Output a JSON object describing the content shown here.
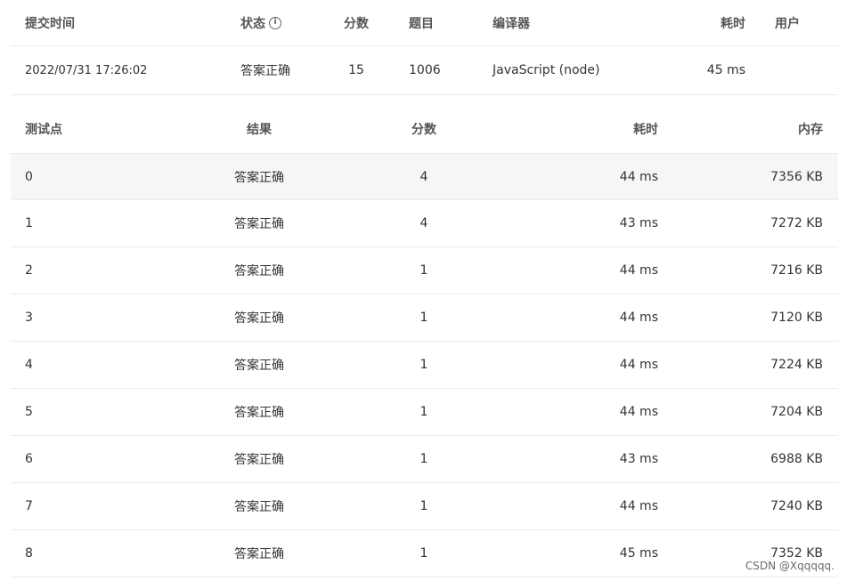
{
  "submission": {
    "headers": {
      "time": "提交时间",
      "status": "状态",
      "score": "分数",
      "problem": "题目",
      "compiler": "编译器",
      "cost": "耗时",
      "user": "用户"
    },
    "status_info_icon": "info-circle-icon",
    "row": {
      "time": "2022/07/31 17:26:02",
      "status": "答案正确",
      "score": "15",
      "problem": "1006",
      "compiler": "JavaScript (node)",
      "cost": "45 ms",
      "user": ""
    }
  },
  "cases": {
    "headers": {
      "id": "测试点",
      "result": "结果",
      "score": "分数",
      "cost": "耗时",
      "memory": "内存"
    },
    "rows": [
      {
        "id": "0",
        "result": "答案正确",
        "score": "4",
        "cost": "44 ms",
        "memory": "7356 KB"
      },
      {
        "id": "1",
        "result": "答案正确",
        "score": "4",
        "cost": "43 ms",
        "memory": "7272 KB"
      },
      {
        "id": "2",
        "result": "答案正确",
        "score": "1",
        "cost": "44 ms",
        "memory": "7216 KB"
      },
      {
        "id": "3",
        "result": "答案正确",
        "score": "1",
        "cost": "44 ms",
        "memory": "7120 KB"
      },
      {
        "id": "4",
        "result": "答案正确",
        "score": "1",
        "cost": "44 ms",
        "memory": "7224 KB"
      },
      {
        "id": "5",
        "result": "答案正确",
        "score": "1",
        "cost": "44 ms",
        "memory": "7204 KB"
      },
      {
        "id": "6",
        "result": "答案正确",
        "score": "1",
        "cost": "43 ms",
        "memory": "6988 KB"
      },
      {
        "id": "7",
        "result": "答案正确",
        "score": "1",
        "cost": "44 ms",
        "memory": "7240 KB"
      },
      {
        "id": "8",
        "result": "答案正确",
        "score": "1",
        "cost": "45 ms",
        "memory": "7352 KB"
      }
    ]
  },
  "colors": {
    "accepted": "#e8433b",
    "link": "#2e8ae6",
    "highlight_row": "#f5f6f7",
    "divider": "#ebebeb"
  },
  "watermark": "CSDN @Xqqqqq."
}
